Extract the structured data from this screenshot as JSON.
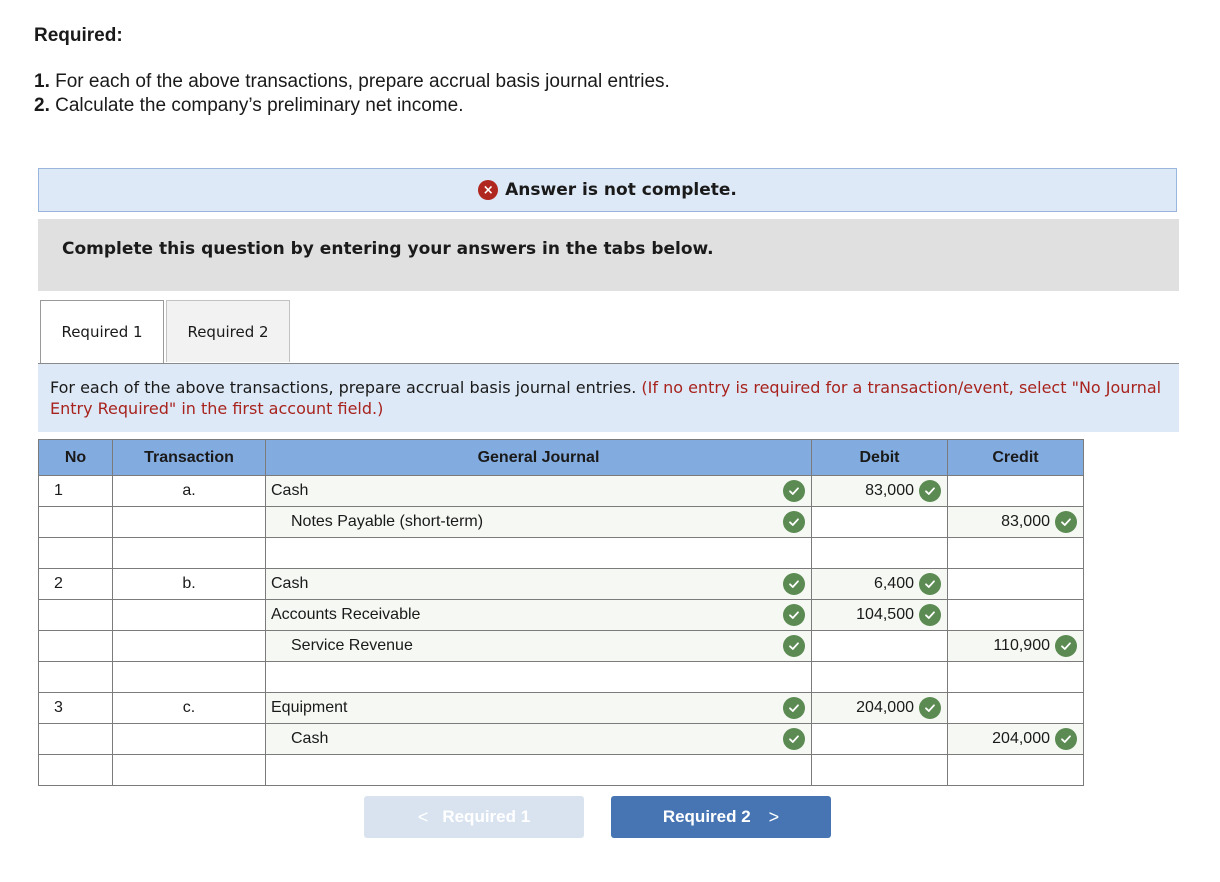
{
  "required": {
    "heading": "Required:",
    "items": [
      {
        "num": "1.",
        "text": " For each of the above transactions, prepare accrual basis journal entries."
      },
      {
        "num": "2.",
        "text": " Calculate the company’s preliminary net income."
      }
    ]
  },
  "status": {
    "icon": "x-circle-icon",
    "glyph": "×",
    "text": "Answer is not complete.",
    "color": "#b0271f"
  },
  "instruction": "Complete this question by entering your answers in the tabs below.",
  "tabs": [
    {
      "label": "Required 1",
      "active": true
    },
    {
      "label": "Required 2",
      "active": false
    }
  ],
  "prompt": {
    "text": "For each of the above transactions, prepare accrual basis journal entries. ",
    "note": "(If no entry is required for a transaction/event, select \"No Journal Entry Required\" in the first account field.)"
  },
  "journal": {
    "headers": {
      "no": "No",
      "transaction": "Transaction",
      "general_journal": "General Journal",
      "debit": "Debit",
      "credit": "Credit"
    },
    "rows": [
      {
        "no": "1",
        "transaction": "a.",
        "account": "Cash",
        "indent": false,
        "debit": "83,000",
        "credit": ""
      },
      {
        "no": "",
        "transaction": "",
        "account": "Notes Payable (short-term)",
        "indent": true,
        "debit": "",
        "credit": "83,000"
      },
      {
        "no": "",
        "transaction": "",
        "account": "",
        "indent": false,
        "debit": "",
        "credit": ""
      },
      {
        "no": "2",
        "transaction": "b.",
        "account": "Cash",
        "indent": false,
        "debit": "6,400",
        "credit": ""
      },
      {
        "no": "",
        "transaction": "",
        "account": "Accounts Receivable",
        "indent": false,
        "debit": "104,500",
        "credit": ""
      },
      {
        "no": "",
        "transaction": "",
        "account": "Service Revenue",
        "indent": true,
        "debit": "",
        "credit": "110,900"
      },
      {
        "no": "",
        "transaction": "",
        "account": "",
        "indent": false,
        "debit": "",
        "credit": ""
      },
      {
        "no": "3",
        "transaction": "c.",
        "account": "Equipment",
        "indent": false,
        "debit": "204,000",
        "credit": ""
      },
      {
        "no": "",
        "transaction": "",
        "account": "Cash",
        "indent": true,
        "debit": "",
        "credit": "204,000"
      },
      {
        "no": "",
        "transaction": "",
        "account": "",
        "indent": false,
        "debit": "",
        "credit": ""
      }
    ],
    "check_icon": "check-circle-icon",
    "check_color": "#5b8a52",
    "header_color": "#82abe0"
  },
  "navigation": {
    "prev": {
      "label": "Required 1",
      "chevron": "<",
      "enabled": false
    },
    "next": {
      "label": "Required 2",
      "chevron": ">",
      "enabled": true
    }
  }
}
